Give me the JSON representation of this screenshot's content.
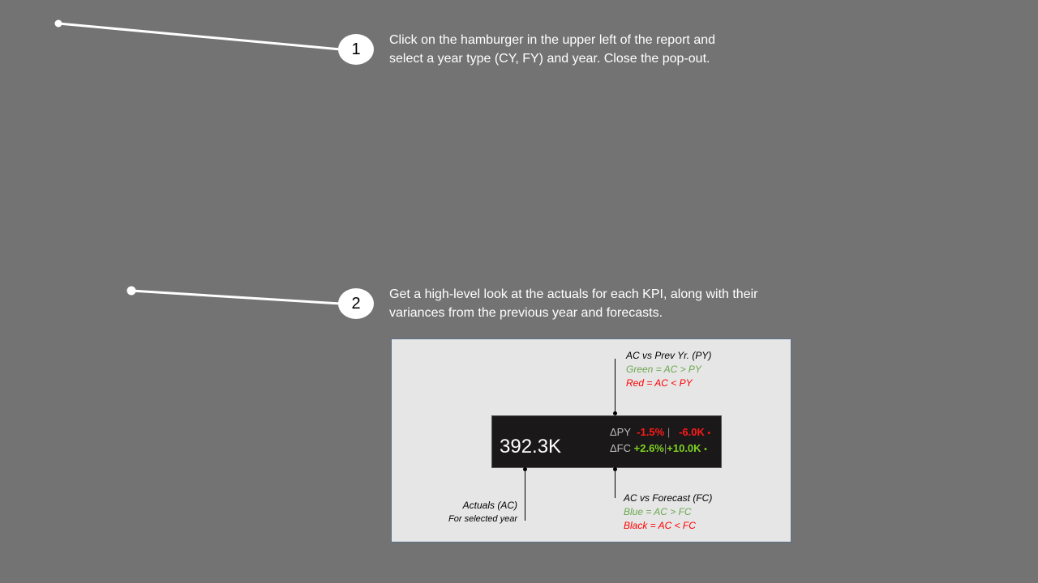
{
  "steps": [
    {
      "number": "1",
      "line1": "Click on the hamburger in the upper left of the report and",
      "line2": "select a year type (CY, FY) and year.  Close the pop-out."
    },
    {
      "number": "2",
      "line1": "Get a high-level look at the actuals for each KPI, along with their",
      "line2": "variances from the previous year and forecasts."
    }
  ],
  "kpi_card": {
    "value": "392.3K",
    "py_label": "ΔPY",
    "py_pct": "-1.5%",
    "py_abs": "-6.0K",
    "py_dot": "•",
    "fc_label": "ΔFC",
    "fc_pct": "+2.6%",
    "fc_abs": "+10.0K",
    "fc_dot": "•",
    "separator": "|",
    "colors": {
      "negative": "#ff1a1a",
      "positive": "#7ed321",
      "card_bg": "#1a1818"
    }
  },
  "annotations": {
    "py": {
      "title": "AC vs Prev Yr. (PY)",
      "green": "Green = AC > PY",
      "red": "Red = AC < PY"
    },
    "fc": {
      "title": "AC vs Forecast (FC)",
      "blue": "Blue = AC > FC",
      "black": "Black = AC < FC"
    },
    "ac": {
      "title": "Actuals (AC)",
      "subtitle": "For selected year"
    }
  }
}
